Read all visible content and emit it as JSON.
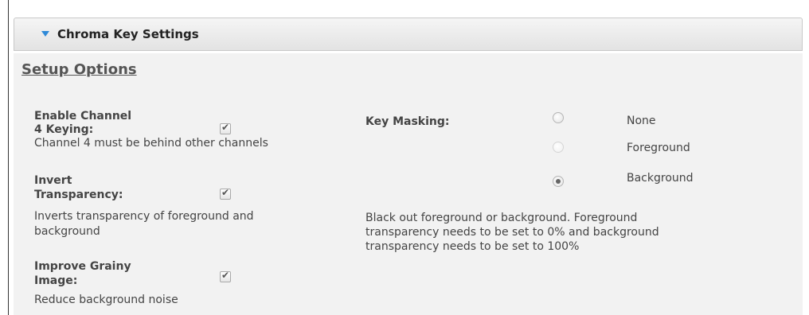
{
  "section": {
    "title": "Chroma Key Settings"
  },
  "setup": {
    "title": "Setup Options"
  },
  "options": {
    "enable_keying": {
      "label_line1": "Enable Channel",
      "label_line2": "4 Keying:",
      "description": "Channel 4 must be behind other channels",
      "checked": true
    },
    "invert_transparency": {
      "label_line1": "Invert",
      "label_line2": "Transparency:",
      "description_line1": "Inverts transparency of foreground and",
      "description_line2": "background",
      "checked": true
    },
    "improve_grainy": {
      "label_line1": "Improve Grainy",
      "label_line2": "Image:",
      "description": "Reduce background noise",
      "checked": true
    }
  },
  "key_masking": {
    "label": "Key Masking:",
    "options": [
      "None",
      "Foreground",
      "Background"
    ],
    "selected": "Background",
    "description_line1": "Black out foreground or background. Foreground",
    "description_line2": "transparency needs to be set to 0% and background",
    "description_line3": "transparency needs to be set to 100%"
  }
}
